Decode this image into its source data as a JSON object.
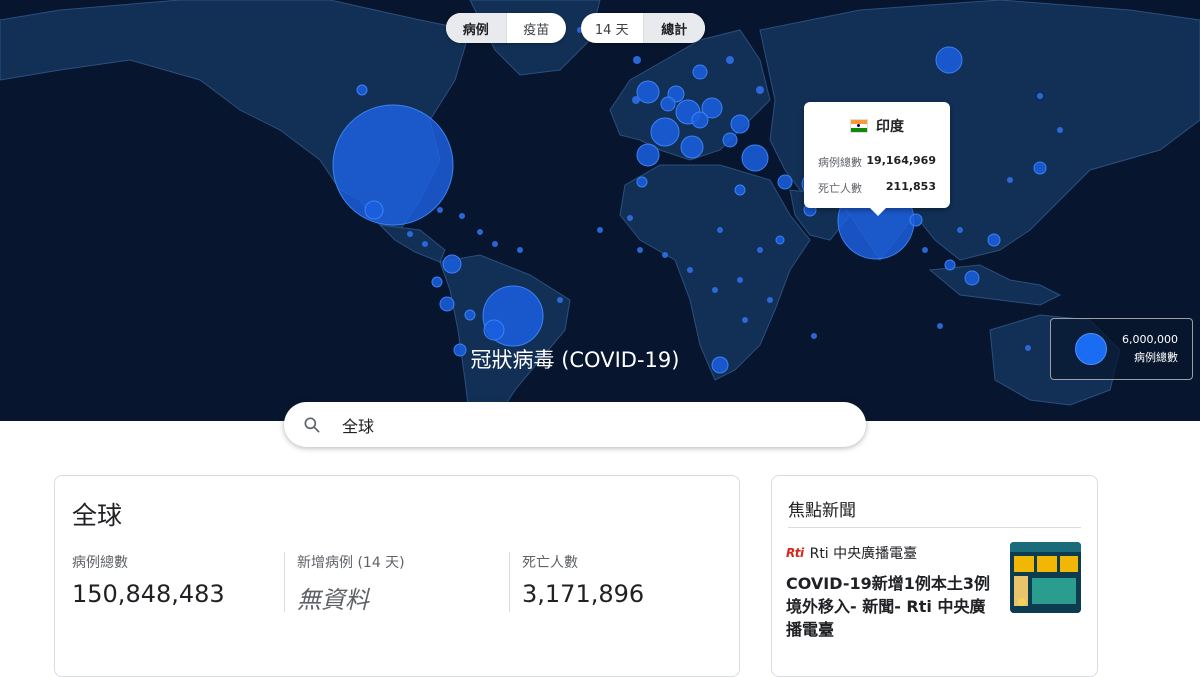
{
  "map": {
    "metric_toggle": [
      {
        "label": "病例",
        "active": true
      },
      {
        "label": "疫苗",
        "active": false
      }
    ],
    "range_toggle": [
      {
        "label": "14 天",
        "active": false
      },
      {
        "label": "總計",
        "active": true
      }
    ],
    "title": "冠狀病毒 (COVID-19)",
    "tooltip": {
      "country": "印度",
      "rows": [
        {
          "label": "病例總數",
          "value": "19,164,969"
        },
        {
          "label": "死亡人數",
          "value": "211,853"
        }
      ]
    },
    "legend": {
      "value": "6,000,000",
      "label": "病例總數"
    },
    "colors": {
      "ocean": "#07152e",
      "land": "#123056",
      "bubble": "#1a6cf2"
    }
  },
  "search": {
    "value": "全球"
  },
  "stats": {
    "title": "全球",
    "total_cases": {
      "label": "病例總數",
      "value": "150,848,483"
    },
    "new_cases": {
      "label": "新增病例 (14 天)",
      "value": "無資料"
    },
    "deaths": {
      "label": "死亡人數",
      "value": "3,171,896"
    }
  },
  "news": {
    "title": "焦點新聞",
    "items": [
      {
        "source_logo": "Rti",
        "source": "Rti 中央廣播電臺",
        "headline": "COVID-19新增1例本土3例境外移入- 新聞- Rti 中央廣播電臺"
      }
    ]
  }
}
